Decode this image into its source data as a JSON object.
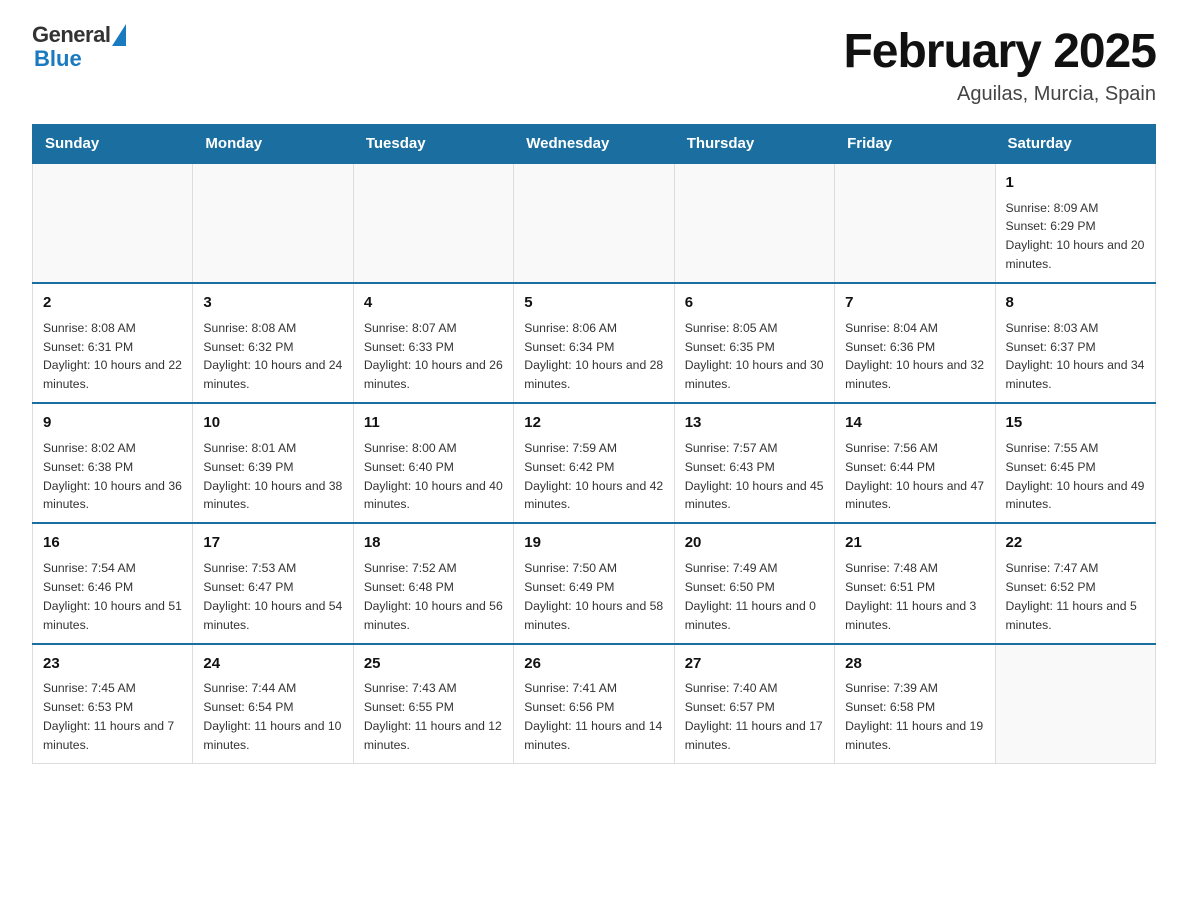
{
  "header": {
    "logo_general": "General",
    "logo_blue": "Blue",
    "title": "February 2025",
    "subtitle": "Aguilas, Murcia, Spain"
  },
  "days_of_week": [
    "Sunday",
    "Monday",
    "Tuesday",
    "Wednesday",
    "Thursday",
    "Friday",
    "Saturday"
  ],
  "weeks": [
    [
      {
        "day": "",
        "info": ""
      },
      {
        "day": "",
        "info": ""
      },
      {
        "day": "",
        "info": ""
      },
      {
        "day": "",
        "info": ""
      },
      {
        "day": "",
        "info": ""
      },
      {
        "day": "",
        "info": ""
      },
      {
        "day": "1",
        "info": "Sunrise: 8:09 AM\nSunset: 6:29 PM\nDaylight: 10 hours and 20 minutes."
      }
    ],
    [
      {
        "day": "2",
        "info": "Sunrise: 8:08 AM\nSunset: 6:31 PM\nDaylight: 10 hours and 22 minutes."
      },
      {
        "day": "3",
        "info": "Sunrise: 8:08 AM\nSunset: 6:32 PM\nDaylight: 10 hours and 24 minutes."
      },
      {
        "day": "4",
        "info": "Sunrise: 8:07 AM\nSunset: 6:33 PM\nDaylight: 10 hours and 26 minutes."
      },
      {
        "day": "5",
        "info": "Sunrise: 8:06 AM\nSunset: 6:34 PM\nDaylight: 10 hours and 28 minutes."
      },
      {
        "day": "6",
        "info": "Sunrise: 8:05 AM\nSunset: 6:35 PM\nDaylight: 10 hours and 30 minutes."
      },
      {
        "day": "7",
        "info": "Sunrise: 8:04 AM\nSunset: 6:36 PM\nDaylight: 10 hours and 32 minutes."
      },
      {
        "day": "8",
        "info": "Sunrise: 8:03 AM\nSunset: 6:37 PM\nDaylight: 10 hours and 34 minutes."
      }
    ],
    [
      {
        "day": "9",
        "info": "Sunrise: 8:02 AM\nSunset: 6:38 PM\nDaylight: 10 hours and 36 minutes."
      },
      {
        "day": "10",
        "info": "Sunrise: 8:01 AM\nSunset: 6:39 PM\nDaylight: 10 hours and 38 minutes."
      },
      {
        "day": "11",
        "info": "Sunrise: 8:00 AM\nSunset: 6:40 PM\nDaylight: 10 hours and 40 minutes."
      },
      {
        "day": "12",
        "info": "Sunrise: 7:59 AM\nSunset: 6:42 PM\nDaylight: 10 hours and 42 minutes."
      },
      {
        "day": "13",
        "info": "Sunrise: 7:57 AM\nSunset: 6:43 PM\nDaylight: 10 hours and 45 minutes."
      },
      {
        "day": "14",
        "info": "Sunrise: 7:56 AM\nSunset: 6:44 PM\nDaylight: 10 hours and 47 minutes."
      },
      {
        "day": "15",
        "info": "Sunrise: 7:55 AM\nSunset: 6:45 PM\nDaylight: 10 hours and 49 minutes."
      }
    ],
    [
      {
        "day": "16",
        "info": "Sunrise: 7:54 AM\nSunset: 6:46 PM\nDaylight: 10 hours and 51 minutes."
      },
      {
        "day": "17",
        "info": "Sunrise: 7:53 AM\nSunset: 6:47 PM\nDaylight: 10 hours and 54 minutes."
      },
      {
        "day": "18",
        "info": "Sunrise: 7:52 AM\nSunset: 6:48 PM\nDaylight: 10 hours and 56 minutes."
      },
      {
        "day": "19",
        "info": "Sunrise: 7:50 AM\nSunset: 6:49 PM\nDaylight: 10 hours and 58 minutes."
      },
      {
        "day": "20",
        "info": "Sunrise: 7:49 AM\nSunset: 6:50 PM\nDaylight: 11 hours and 0 minutes."
      },
      {
        "day": "21",
        "info": "Sunrise: 7:48 AM\nSunset: 6:51 PM\nDaylight: 11 hours and 3 minutes."
      },
      {
        "day": "22",
        "info": "Sunrise: 7:47 AM\nSunset: 6:52 PM\nDaylight: 11 hours and 5 minutes."
      }
    ],
    [
      {
        "day": "23",
        "info": "Sunrise: 7:45 AM\nSunset: 6:53 PM\nDaylight: 11 hours and 7 minutes."
      },
      {
        "day": "24",
        "info": "Sunrise: 7:44 AM\nSunset: 6:54 PM\nDaylight: 11 hours and 10 minutes."
      },
      {
        "day": "25",
        "info": "Sunrise: 7:43 AM\nSunset: 6:55 PM\nDaylight: 11 hours and 12 minutes."
      },
      {
        "day": "26",
        "info": "Sunrise: 7:41 AM\nSunset: 6:56 PM\nDaylight: 11 hours and 14 minutes."
      },
      {
        "day": "27",
        "info": "Sunrise: 7:40 AM\nSunset: 6:57 PM\nDaylight: 11 hours and 17 minutes."
      },
      {
        "day": "28",
        "info": "Sunrise: 7:39 AM\nSunset: 6:58 PM\nDaylight: 11 hours and 19 minutes."
      },
      {
        "day": "",
        "info": ""
      }
    ]
  ],
  "colors": {
    "header_bg": "#1a6fa0",
    "header_text": "#ffffff",
    "border": "#1a6fa0"
  }
}
